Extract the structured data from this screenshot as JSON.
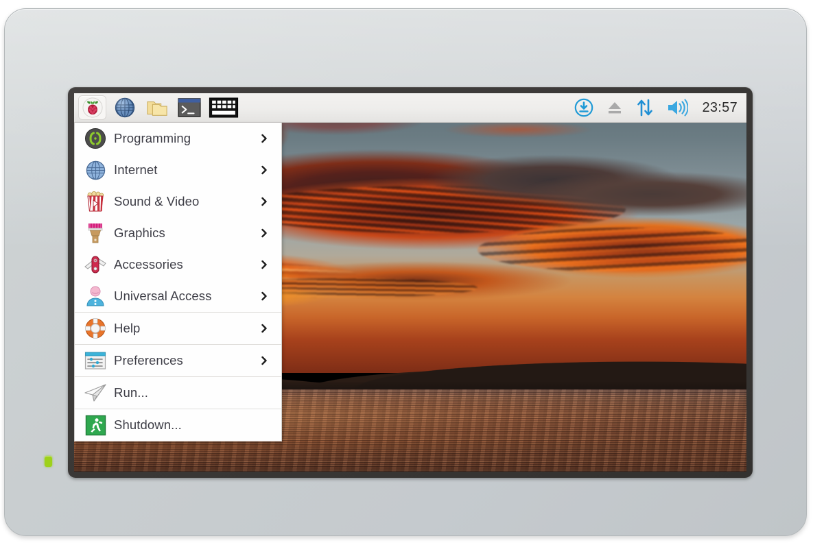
{
  "device": {
    "name": "raspberry-pi-touch-display",
    "case_color": "#c9ced0",
    "bezel_color": "#3b3937",
    "led_color": "#9ed11a"
  },
  "taskbar": {
    "clock": "23:57",
    "launchers": [
      {
        "name": "menu-button",
        "icon": "raspberry-logo-icon",
        "label": "Menu"
      },
      {
        "name": "web-browser-button",
        "icon": "globe-icon",
        "label": "Web Browser"
      },
      {
        "name": "file-manager-button",
        "icon": "folder-icon",
        "label": "File Manager"
      },
      {
        "name": "terminal-button",
        "icon": "terminal-icon",
        "label": "Terminal"
      },
      {
        "name": "keyboard-button",
        "icon": "keyboard-icon",
        "label": "On-screen Keyboard"
      }
    ],
    "tray": [
      {
        "name": "updates-available-icon",
        "icon": "download-circle-icon",
        "label": "Updates Available",
        "color": "#1f9ad6"
      },
      {
        "name": "eject-icon",
        "icon": "eject-icon",
        "label": "Eject",
        "color": "#a8a8a8"
      },
      {
        "name": "network-icon",
        "icon": "up-down-arrows-icon",
        "label": "Network",
        "color": "#1f9ad6"
      },
      {
        "name": "volume-icon",
        "icon": "speaker-icon",
        "label": "Volume",
        "color": "#3aa7e0"
      }
    ]
  },
  "menu": {
    "items": [
      {
        "label": "Programming",
        "icon": "braces-icon",
        "submenu": true,
        "separator_before": false
      },
      {
        "label": "Internet",
        "icon": "globe-icon",
        "submenu": true,
        "separator_before": false
      },
      {
        "label": "Sound & Video",
        "icon": "popcorn-icon",
        "submenu": true,
        "separator_before": false
      },
      {
        "label": "Graphics",
        "icon": "paintbrush-icon",
        "submenu": true,
        "separator_before": false
      },
      {
        "label": "Accessories",
        "icon": "pocketknife-icon",
        "submenu": true,
        "separator_before": false
      },
      {
        "label": "Universal Access",
        "icon": "person-icon",
        "submenu": true,
        "separator_before": false
      },
      {
        "label": "Help",
        "icon": "lifebuoy-icon",
        "submenu": true,
        "separator_before": true
      },
      {
        "label": "Preferences",
        "icon": "sliders-window-icon",
        "submenu": true,
        "separator_before": true
      },
      {
        "label": "Run...",
        "icon": "paper-plane-icon",
        "submenu": false,
        "separator_before": true
      },
      {
        "label": "Shutdown...",
        "icon": "exit-runner-icon",
        "submenu": false,
        "separator_before": true
      }
    ]
  },
  "wallpaper": {
    "description": "Sunset over water with fiery orange and red clouds, dark mountain silhouette",
    "sky_color": "#8b979b",
    "cloud_color": "#e8631f",
    "water_color": "#86583f"
  }
}
